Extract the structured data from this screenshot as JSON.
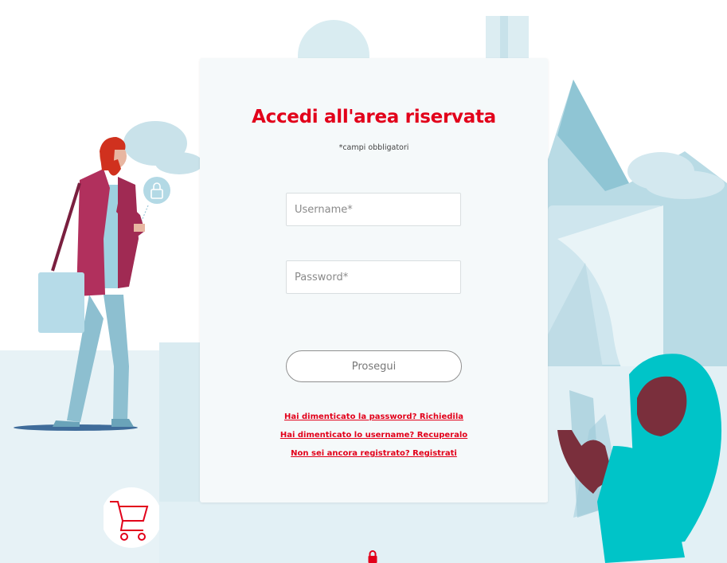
{
  "login": {
    "title": "Accedi all'area riservata",
    "required_note": "*campi obbligatori",
    "username_placeholder": "Username*",
    "password_placeholder": "Password*",
    "submit_label": "Prosegui",
    "links": {
      "forgot_password": "Hai dimenticato la password? Richiedila",
      "forgot_username": "Hai dimenticato lo username? Recuperalo",
      "register": "Non sei ancora registrato? Registrati"
    }
  },
  "icons": {
    "padlock": "lock-icon",
    "cart": "cart-icon",
    "bottom_lock": "lock-icon"
  },
  "colors": {
    "accent": "#e2001a",
    "background_pale": "#d7ebf1",
    "background_light": "#e6f2f6",
    "teal": "#00c4c8",
    "magenta": "#b1305d",
    "leg_blue": "#7fb5c8"
  }
}
